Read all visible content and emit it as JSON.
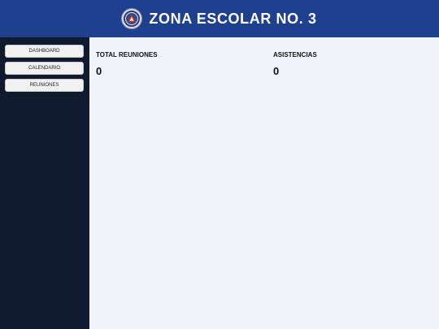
{
  "header": {
    "title": "ZONA ESCOLAR NO. 3",
    "logo_icon": "school-zone-emblem-icon",
    "background_color": "#1f3f8f"
  },
  "sidebar": {
    "background_color": "#101a2e",
    "items": [
      {
        "label": "DASHBOARD"
      },
      {
        "label": "CALENDARIO"
      },
      {
        "label": "REUNIONES"
      }
    ]
  },
  "main": {
    "background_color": "#f1f4fb",
    "stats": [
      {
        "label": "TOTAL REUNIONES",
        "value": "0"
      },
      {
        "label": "ASISTENCIAS",
        "value": "0"
      }
    ]
  }
}
